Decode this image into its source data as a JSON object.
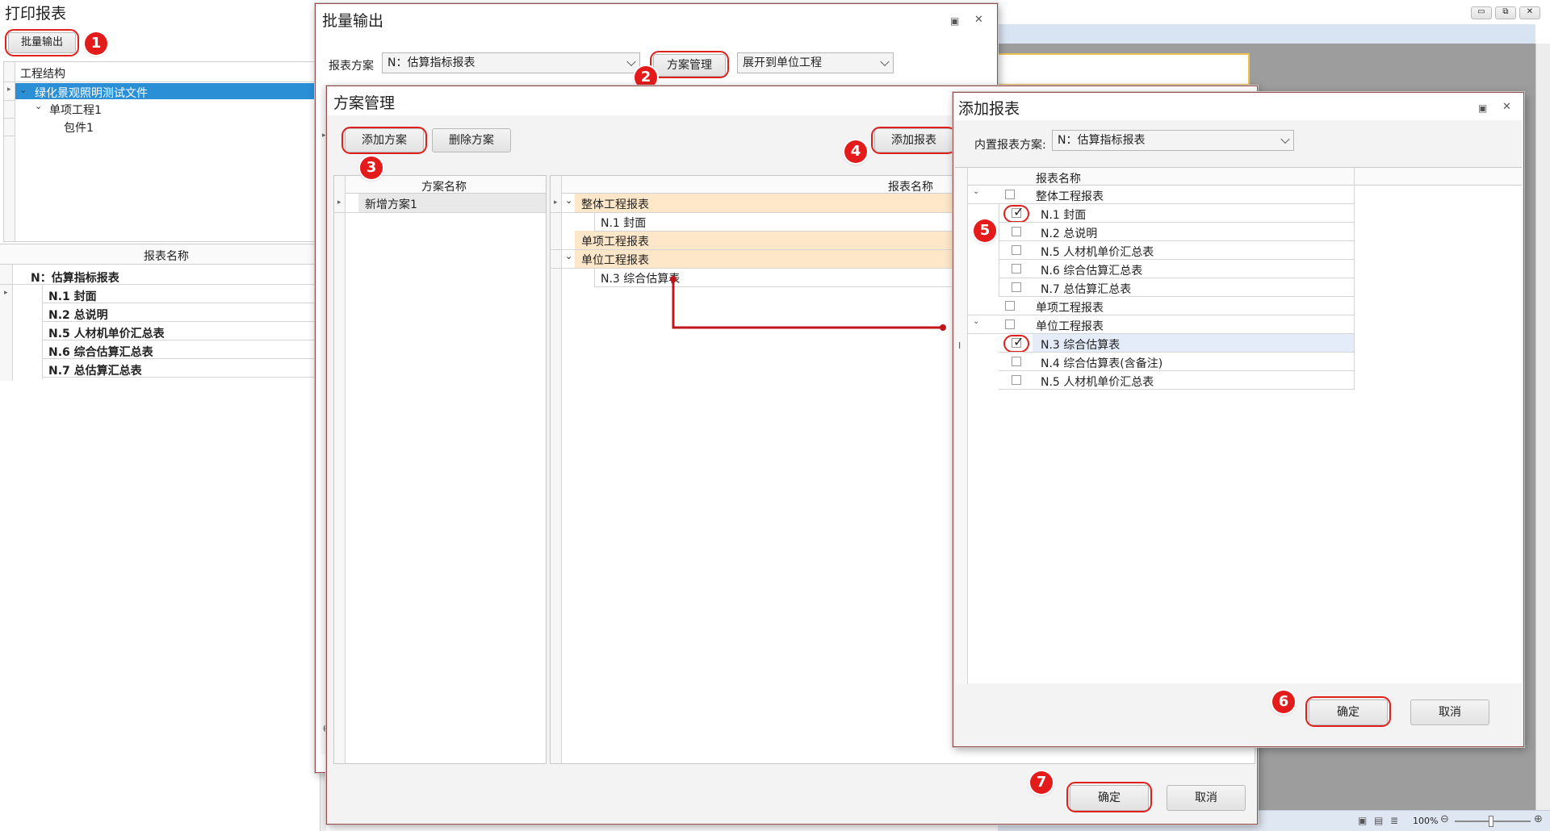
{
  "main": {
    "title": "打印报表",
    "batch_button": "批量输出",
    "tree_header": "工程结构",
    "tree": [
      "绿化景观照明测试文件",
      "单项工程1",
      "包件1"
    ],
    "report_header": "报表名称",
    "reports": [
      "N：估算指标报表",
      "N.1 封面",
      "N.2 总说明",
      "N.5 人材机单价汇总表",
      "N.6 综合估算汇总表",
      "N.7 总估算汇总表"
    ],
    "zoom": "100%"
  },
  "batch": {
    "title": "批量输出",
    "scheme_label": "报表方案",
    "scheme_value": "N：估算指标报表",
    "manage_button": "方案管理",
    "expand_value": "展开到单位工程"
  },
  "manage": {
    "title": "方案管理",
    "add_scheme": "添加方案",
    "delete_scheme": "删除方案",
    "add_report": "添加报表",
    "scheme_header": "方案名称",
    "schemes": [
      "新增方案1"
    ],
    "report_header": "报表名称",
    "report_rows": [
      {
        "label": "整体工程报表",
        "group": true
      },
      {
        "label": "N.1 封面",
        "group": false
      },
      {
        "label": "单项工程报表",
        "group": true
      },
      {
        "label": "单位工程报表",
        "group": true
      },
      {
        "label": "N.3 综合估算表",
        "group": false
      }
    ],
    "ok": "确定",
    "cancel": "取消"
  },
  "addreport": {
    "title": "添加报表",
    "builtin_label": "内置报表方案:",
    "builtin_value": "N：估算指标报表",
    "header": "报表名称",
    "rows": [
      {
        "label": "整体工程报表",
        "checked": false,
        "group": true
      },
      {
        "label": "N.1 封面",
        "checked": true,
        "group": false
      },
      {
        "label": "N.2 总说明",
        "checked": false,
        "group": false
      },
      {
        "label": "N.5 人材机单价汇总表",
        "checked": false,
        "group": false
      },
      {
        "label": "N.6 综合估算汇总表",
        "checked": false,
        "group": false
      },
      {
        "label": "N.7 总估算汇总表",
        "checked": false,
        "group": false
      },
      {
        "label": "单项工程报表",
        "checked": false,
        "group": true
      },
      {
        "label": "单位工程报表",
        "checked": false,
        "group": true
      },
      {
        "label": "N.3 综合估算表",
        "checked": true,
        "group": false
      },
      {
        "label": "N.4 综合估算表(含备注)",
        "checked": false,
        "group": false
      },
      {
        "label": "N.5 人材机单价汇总表",
        "checked": false,
        "group": false
      }
    ],
    "ok": "确定",
    "cancel": "取消"
  },
  "steps": [
    "1",
    "2",
    "3",
    "4",
    "5",
    "6",
    "7"
  ],
  "colors": {
    "highlight": "#e0201c",
    "badge": "#e31b1b",
    "selection": "#2b8fd6",
    "group_row": "#fde7c8",
    "accent_line": "#c0151a"
  }
}
